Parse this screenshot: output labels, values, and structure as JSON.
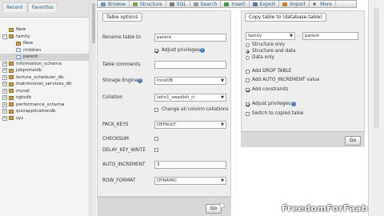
{
  "nav": {
    "tabs": [
      "Recent",
      "Favorites"
    ],
    "tree": [
      {
        "label": "New",
        "kind": "new",
        "level": 0
      },
      {
        "label": "family",
        "kind": "db",
        "level": 0,
        "expanded": true
      },
      {
        "label": "New",
        "kind": "new",
        "level": 1
      },
      {
        "label": "children",
        "kind": "table",
        "level": 1
      },
      {
        "label": "parent",
        "kind": "table",
        "level": 1,
        "selected": true
      },
      {
        "label": "information_schema",
        "kind": "db",
        "level": 0
      },
      {
        "label": "jobportaldb",
        "kind": "db",
        "level": 0
      },
      {
        "label": "lecture_scheduler_db",
        "kind": "db",
        "level": 0
      },
      {
        "label": "matrimonial_services_db",
        "kind": "db",
        "level": 0
      },
      {
        "label": "mysql",
        "kind": "db",
        "level": 0
      },
      {
        "label": "ogtsdb",
        "kind": "db",
        "level": 0
      },
      {
        "label": "performance_schema",
        "kind": "db",
        "level": 0
      },
      {
        "label": "quizapplicationdb",
        "kind": "db",
        "level": 0
      },
      {
        "label": "sys",
        "kind": "db",
        "level": 0
      }
    ]
  },
  "topmenu": {
    "items": [
      {
        "label": "Browse",
        "color": "#6f90b8"
      },
      {
        "label": "Structure",
        "color": "#7aa35a"
      },
      {
        "label": "SQL",
        "color": "#7b7b7b"
      },
      {
        "label": "Search",
        "color": "#9a9a9a"
      },
      {
        "label": "Insert",
        "color": "#3d9a4a"
      },
      {
        "label": "Export",
        "color": "#5b78a6"
      },
      {
        "label": "Import",
        "color": "#c97b2e"
      },
      {
        "label": "More",
        "color": "#444444"
      }
    ]
  },
  "table_options": {
    "legend": "Table options",
    "rename_label": "Rename table to",
    "rename_value": "parent",
    "adjust_privileges_label": "Adjust privileges",
    "comments_label": "Table comments",
    "comments_value": "",
    "engine_label": "Storage Engine",
    "engine_value": "InnoDB",
    "collation_label": "Collation",
    "collation_value": "latin1_swedish_ci",
    "change_collations_label": "Change all column collations",
    "pack_keys_label": "PACK_KEYS",
    "pack_keys_value": "DEFAULT",
    "checksum_label": "CHECKSUM",
    "delay_key_write_label": "DELAY_KEY_WRITE",
    "auto_increment_label": "AUTO_INCREMENT",
    "auto_increment_value": "3",
    "row_format_label": "ROW_FORMAT",
    "row_format_value": "DYNAMIC",
    "go_label": "Go"
  },
  "copy_table": {
    "legend": "Copy table to (database.table)",
    "db_value": "family",
    "sep": ".",
    "table_value": "parent",
    "radios": [
      {
        "label": "Structure only",
        "checked": false
      },
      {
        "label": "Structure and data",
        "checked": true
      },
      {
        "label": "Data only",
        "checked": false
      }
    ],
    "checks": [
      {
        "label": "Add DROP TABLE",
        "checked": false
      },
      {
        "label": "Add AUTO_INCREMENT value",
        "checked": false
      },
      {
        "label": "Add constraints",
        "checked": true
      },
      {
        "label": "Adjust privileges",
        "checked": true
      },
      {
        "label": "Switch to copied table",
        "checked": false
      }
    ],
    "go_label": "Go"
  },
  "help_icon": "?",
  "watermark": "FreedomForFaab"
}
